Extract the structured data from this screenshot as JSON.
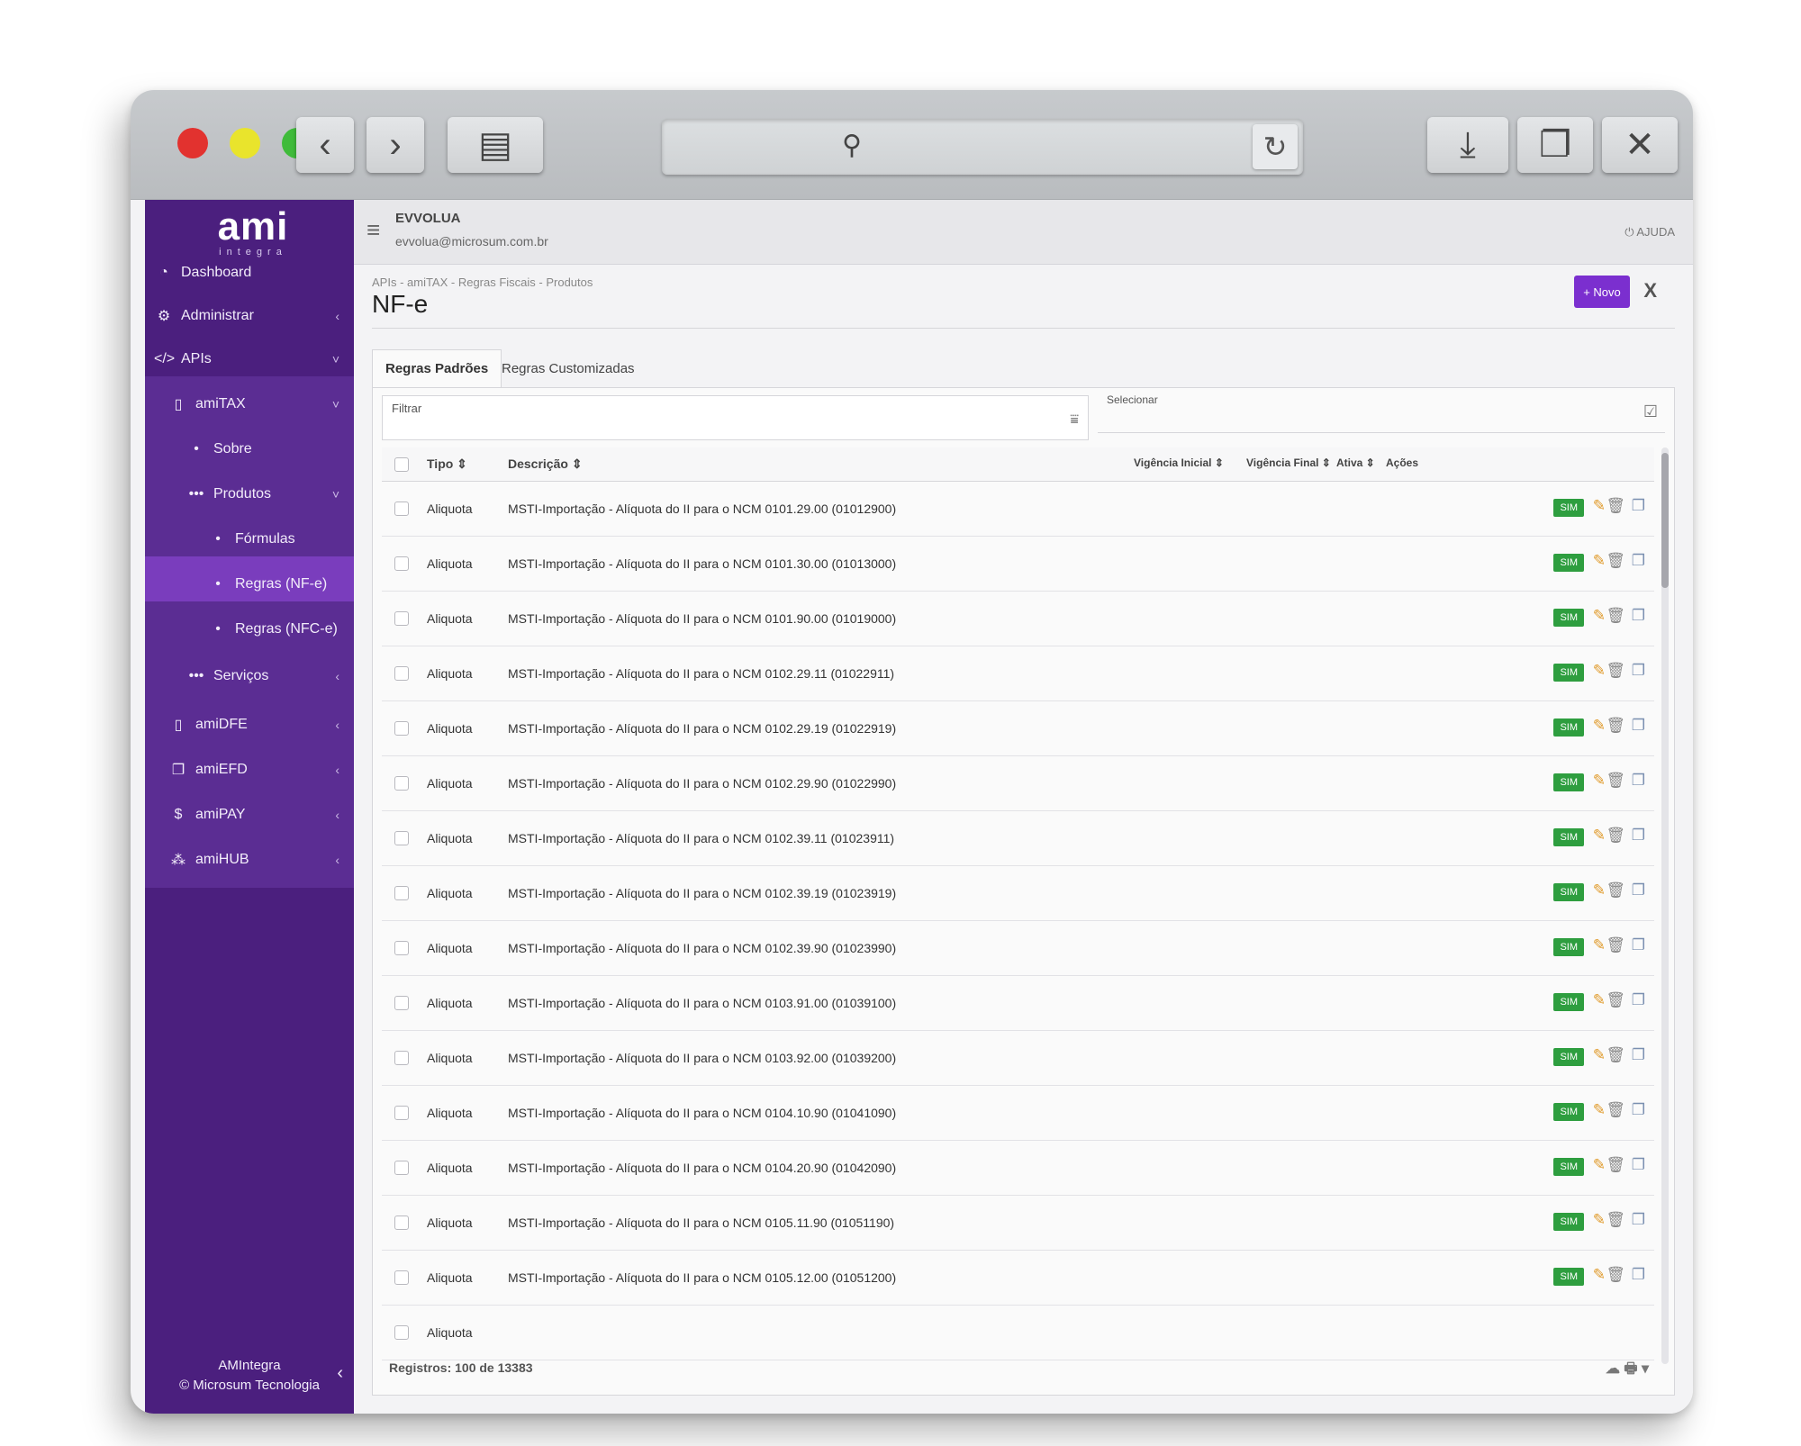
{
  "browser": {
    "back": "‹",
    "forward": "›",
    "sidebar_toggle": "▤",
    "search_glyph": "⚲",
    "reload": "↻",
    "download": "⤓",
    "copy": "❐",
    "close": "✕"
  },
  "sidebar": {
    "logo_main": "ami",
    "logo_sub": "integra",
    "items": [
      {
        "label": "Dashboard",
        "icon": "◔"
      },
      {
        "label": "Administrar",
        "icon": "⚙",
        "chev": "‹"
      },
      {
        "label": "APIs",
        "icon": "</>",
        "chev": "˅"
      },
      {
        "label": "amiTAX",
        "icon": "▯",
        "chev": "˅"
      },
      {
        "label": "Sobre",
        "icon": "•"
      },
      {
        "label": "Produtos",
        "icon": "•••",
        "chev": "˅"
      },
      {
        "label": "Fórmulas",
        "icon": "•"
      },
      {
        "label": "Regras (NF-e)",
        "icon": "•"
      },
      {
        "label": "Regras (NFC-e)",
        "icon": "•"
      },
      {
        "label": "Serviços",
        "icon": "•••",
        "chev": "‹"
      },
      {
        "label": "amiDFE",
        "icon": "▯",
        "chev": "‹"
      },
      {
        "label": "amiEFD",
        "icon": "❐",
        "chev": "‹"
      },
      {
        "label": "amiPAY",
        "icon": "$",
        "chev": "‹"
      },
      {
        "label": "amiHUB",
        "icon": "⁂",
        "chev": "‹"
      }
    ],
    "footer_line1": "AMIntegra",
    "footer_line2": "© Microsum Tecnologia",
    "footer_back": "‹"
  },
  "topbar": {
    "menu_icon": "≡",
    "company": "EVVOLUA",
    "email": "evvolua@microsum.com.br",
    "help": "⏻ AJUDA"
  },
  "page": {
    "breadcrumb": "APIs - amiTAX - Regras Fiscais - Produtos",
    "title": "NF-e",
    "new_button": "+ Novo",
    "close": "X"
  },
  "tabs": [
    {
      "label": "Regras Padrões"
    },
    {
      "label": "Regras Customizadas"
    }
  ],
  "filter": {
    "label": "Filtrar",
    "icon": "⩸"
  },
  "select": {
    "label": "Selecionar",
    "icon": "☑"
  },
  "table": {
    "columns": {
      "tipo": "Tipo ⇕",
      "descricao": "Descrição ⇕",
      "vigencia_inicial": "Vigência Inicial ⇕",
      "vigencia_final": "Vigência Final ⇕",
      "ativa": "Ativa ⇕",
      "acoes": "Ações"
    },
    "rows": [
      {
        "tipo": "Aliquota",
        "descricao": "MSTI-Importação - Alíquota do II para o NCM 0101.29.00 (01012900)",
        "ativa": "SIM"
      },
      {
        "tipo": "Aliquota",
        "descricao": "MSTI-Importação - Alíquota do II para o NCM 0101.30.00 (01013000)",
        "ativa": "SIM"
      },
      {
        "tipo": "Aliquota",
        "descricao": "MSTI-Importação - Alíquota do II para o NCM 0101.90.00 (01019000)",
        "ativa": "SIM"
      },
      {
        "tipo": "Aliquota",
        "descricao": "MSTI-Importação - Alíquota do II para o NCM 0102.29.11 (01022911)",
        "ativa": "SIM"
      },
      {
        "tipo": "Aliquota",
        "descricao": "MSTI-Importação - Alíquota do II para o NCM 0102.29.19 (01022919)",
        "ativa": "SIM"
      },
      {
        "tipo": "Aliquota",
        "descricao": "MSTI-Importação - Alíquota do II para o NCM 0102.29.90 (01022990)",
        "ativa": "SIM"
      },
      {
        "tipo": "Aliquota",
        "descricao": "MSTI-Importação - Alíquota do II para o NCM 0102.39.11 (01023911)",
        "ativa": "SIM"
      },
      {
        "tipo": "Aliquota",
        "descricao": "MSTI-Importação - Alíquota do II para o NCM 0102.39.19 (01023919)",
        "ativa": "SIM"
      },
      {
        "tipo": "Aliquota",
        "descricao": "MSTI-Importação - Alíquota do II para o NCM 0102.39.90 (01023990)",
        "ativa": "SIM"
      },
      {
        "tipo": "Aliquota",
        "descricao": "MSTI-Importação - Alíquota do II para o NCM 0103.91.00 (01039100)",
        "ativa": "SIM"
      },
      {
        "tipo": "Aliquota",
        "descricao": "MSTI-Importação - Alíquota do II para o NCM 0103.92.00 (01039200)",
        "ativa": "SIM"
      },
      {
        "tipo": "Aliquota",
        "descricao": "MSTI-Importação - Alíquota do II para o NCM 0104.10.90 (01041090)",
        "ativa": "SIM"
      },
      {
        "tipo": "Aliquota",
        "descricao": "MSTI-Importação - Alíquota do II para o NCM 0104.20.90 (01042090)",
        "ativa": "SIM"
      },
      {
        "tipo": "Aliquota",
        "descricao": "MSTI-Importação - Alíquota do II para o NCM 0105.11.90 (01051190)",
        "ativa": "SIM"
      },
      {
        "tipo": "Aliquota",
        "descricao": "MSTI-Importação - Alíquota do II para o NCM 0105.12.00 (01051200)",
        "ativa": "SIM"
      },
      {
        "tipo": "Aliquota",
        "descricao": "",
        "ativa": ""
      }
    ],
    "action_icons": {
      "edit": "✎",
      "delete": "🗑",
      "copy": "❐"
    }
  },
  "footer": {
    "records": "Registros: 100 de 13383",
    "tools": "☁ 🖶 ▾"
  },
  "colors": {
    "sidebar": "#4b1f7e",
    "sidebar_active": "#7a3dbd",
    "primary": "#7b2fcf",
    "success": "#2e9e3f"
  }
}
